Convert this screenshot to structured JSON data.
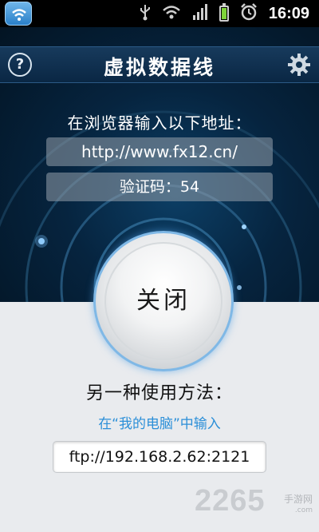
{
  "status_bar": {
    "time": "16:09",
    "icons": [
      "usb-icon",
      "wifi-icon",
      "signal-icon",
      "battery-icon",
      "alarm-icon"
    ]
  },
  "header": {
    "title": "虚拟数据线",
    "help_label": "?"
  },
  "main": {
    "instruction": "在浏览器输入以下地址：",
    "address": "http://www.fx12.cn/",
    "verification_code": "验证码：54",
    "close_button": "关闭"
  },
  "alternative": {
    "title": "另一种使用方法：",
    "hint": "在“我的电脑”中输入",
    "ftp_address": "ftp://192.168.2.62:2121"
  },
  "watermark": {
    "digits": "2265",
    "suffix": ".com",
    "site_name": "手游网"
  },
  "colors": {
    "panel_dark": "#06243f",
    "accent_blue": "#2b8fd8",
    "ring_blue": "#7fb8e6",
    "page_bg": "#e9ebee"
  }
}
